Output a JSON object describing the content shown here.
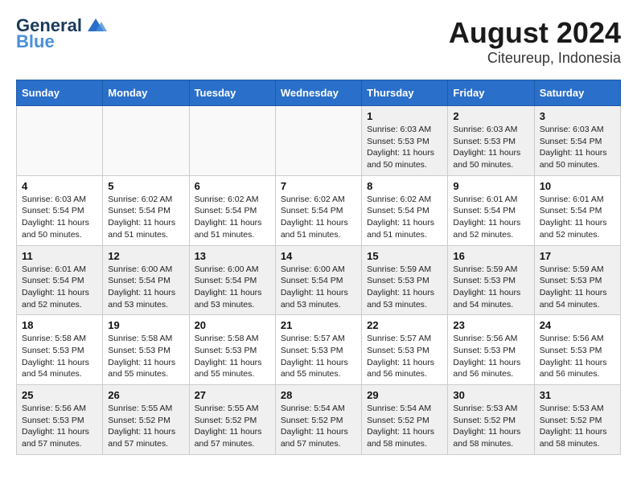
{
  "header": {
    "logo_text_main": "General",
    "logo_text_sub": "Blue",
    "title": "August 2024",
    "subtitle": "Citeureup, Indonesia"
  },
  "weekdays": [
    "Sunday",
    "Monday",
    "Tuesday",
    "Wednesday",
    "Thursday",
    "Friday",
    "Saturday"
  ],
  "weeks": [
    [
      {
        "day": "",
        "info": ""
      },
      {
        "day": "",
        "info": ""
      },
      {
        "day": "",
        "info": ""
      },
      {
        "day": "",
        "info": ""
      },
      {
        "day": "1",
        "info": "Sunrise: 6:03 AM\nSunset: 5:53 PM\nDaylight: 11 hours\nand 50 minutes."
      },
      {
        "day": "2",
        "info": "Sunrise: 6:03 AM\nSunset: 5:53 PM\nDaylight: 11 hours\nand 50 minutes."
      },
      {
        "day": "3",
        "info": "Sunrise: 6:03 AM\nSunset: 5:54 PM\nDaylight: 11 hours\nand 50 minutes."
      }
    ],
    [
      {
        "day": "4",
        "info": "Sunrise: 6:03 AM\nSunset: 5:54 PM\nDaylight: 11 hours\nand 50 minutes."
      },
      {
        "day": "5",
        "info": "Sunrise: 6:02 AM\nSunset: 5:54 PM\nDaylight: 11 hours\nand 51 minutes."
      },
      {
        "day": "6",
        "info": "Sunrise: 6:02 AM\nSunset: 5:54 PM\nDaylight: 11 hours\nand 51 minutes."
      },
      {
        "day": "7",
        "info": "Sunrise: 6:02 AM\nSunset: 5:54 PM\nDaylight: 11 hours\nand 51 minutes."
      },
      {
        "day": "8",
        "info": "Sunrise: 6:02 AM\nSunset: 5:54 PM\nDaylight: 11 hours\nand 51 minutes."
      },
      {
        "day": "9",
        "info": "Sunrise: 6:01 AM\nSunset: 5:54 PM\nDaylight: 11 hours\nand 52 minutes."
      },
      {
        "day": "10",
        "info": "Sunrise: 6:01 AM\nSunset: 5:54 PM\nDaylight: 11 hours\nand 52 minutes."
      }
    ],
    [
      {
        "day": "11",
        "info": "Sunrise: 6:01 AM\nSunset: 5:54 PM\nDaylight: 11 hours\nand 52 minutes."
      },
      {
        "day": "12",
        "info": "Sunrise: 6:00 AM\nSunset: 5:54 PM\nDaylight: 11 hours\nand 53 minutes."
      },
      {
        "day": "13",
        "info": "Sunrise: 6:00 AM\nSunset: 5:54 PM\nDaylight: 11 hours\nand 53 minutes."
      },
      {
        "day": "14",
        "info": "Sunrise: 6:00 AM\nSunset: 5:54 PM\nDaylight: 11 hours\nand 53 minutes."
      },
      {
        "day": "15",
        "info": "Sunrise: 5:59 AM\nSunset: 5:53 PM\nDaylight: 11 hours\nand 53 minutes."
      },
      {
        "day": "16",
        "info": "Sunrise: 5:59 AM\nSunset: 5:53 PM\nDaylight: 11 hours\nand 54 minutes."
      },
      {
        "day": "17",
        "info": "Sunrise: 5:59 AM\nSunset: 5:53 PM\nDaylight: 11 hours\nand 54 minutes."
      }
    ],
    [
      {
        "day": "18",
        "info": "Sunrise: 5:58 AM\nSunset: 5:53 PM\nDaylight: 11 hours\nand 54 minutes."
      },
      {
        "day": "19",
        "info": "Sunrise: 5:58 AM\nSunset: 5:53 PM\nDaylight: 11 hours\nand 55 minutes."
      },
      {
        "day": "20",
        "info": "Sunrise: 5:58 AM\nSunset: 5:53 PM\nDaylight: 11 hours\nand 55 minutes."
      },
      {
        "day": "21",
        "info": "Sunrise: 5:57 AM\nSunset: 5:53 PM\nDaylight: 11 hours\nand 55 minutes."
      },
      {
        "day": "22",
        "info": "Sunrise: 5:57 AM\nSunset: 5:53 PM\nDaylight: 11 hours\nand 56 minutes."
      },
      {
        "day": "23",
        "info": "Sunrise: 5:56 AM\nSunset: 5:53 PM\nDaylight: 11 hours\nand 56 minutes."
      },
      {
        "day": "24",
        "info": "Sunrise: 5:56 AM\nSunset: 5:53 PM\nDaylight: 11 hours\nand 56 minutes."
      }
    ],
    [
      {
        "day": "25",
        "info": "Sunrise: 5:56 AM\nSunset: 5:53 PM\nDaylight: 11 hours\nand 57 minutes."
      },
      {
        "day": "26",
        "info": "Sunrise: 5:55 AM\nSunset: 5:52 PM\nDaylight: 11 hours\nand 57 minutes."
      },
      {
        "day": "27",
        "info": "Sunrise: 5:55 AM\nSunset: 5:52 PM\nDaylight: 11 hours\nand 57 minutes."
      },
      {
        "day": "28",
        "info": "Sunrise: 5:54 AM\nSunset: 5:52 PM\nDaylight: 11 hours\nand 57 minutes."
      },
      {
        "day": "29",
        "info": "Sunrise: 5:54 AM\nSunset: 5:52 PM\nDaylight: 11 hours\nand 58 minutes."
      },
      {
        "day": "30",
        "info": "Sunrise: 5:53 AM\nSunset: 5:52 PM\nDaylight: 11 hours\nand 58 minutes."
      },
      {
        "day": "31",
        "info": "Sunrise: 5:53 AM\nSunset: 5:52 PM\nDaylight: 11 hours\nand 58 minutes."
      }
    ]
  ]
}
